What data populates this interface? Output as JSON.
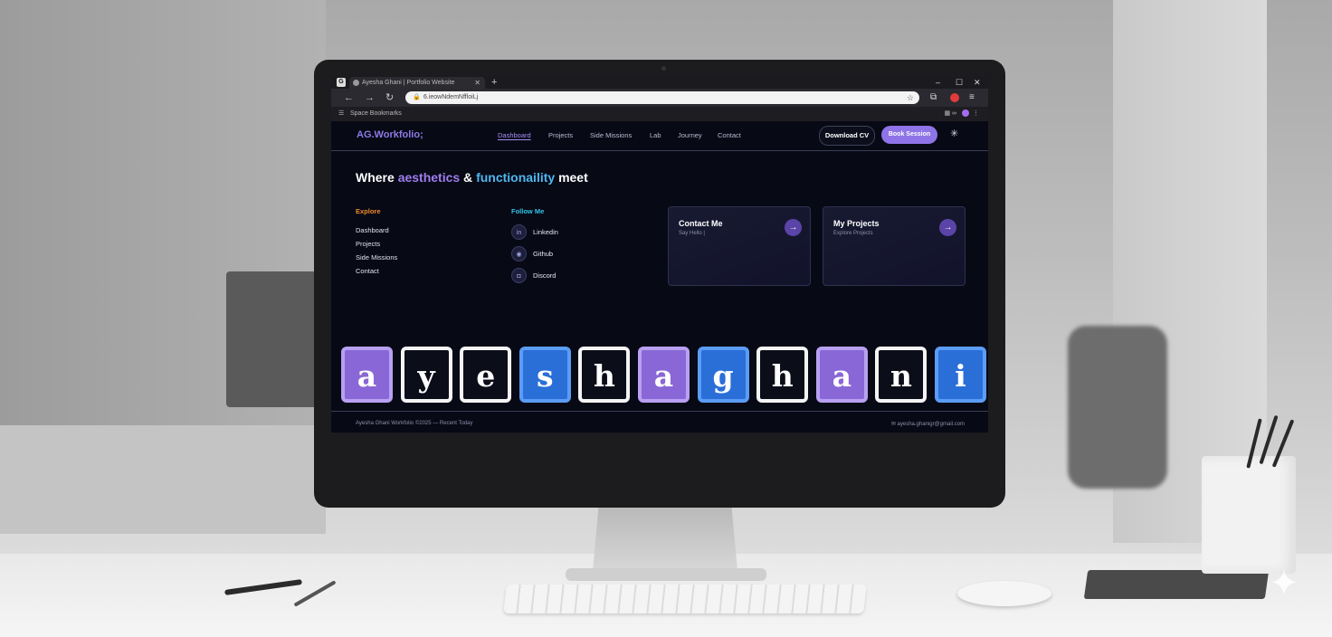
{
  "browser": {
    "app_icon": "G",
    "tab_title": "Ayesha Ghani | Portfolio Website",
    "url": "6.ieowNdemNffloiLj",
    "bookmark_label": "Space Bookmarks",
    "window_controls": [
      "–",
      "☐",
      "✕"
    ]
  },
  "site": {
    "logo": "AG.Workfolio;",
    "nav": [
      {
        "label": "Dashboard",
        "active": true
      },
      {
        "label": "Projects",
        "active": false
      },
      {
        "label": "Side Missions",
        "active": false
      },
      {
        "label": "Lab",
        "active": false
      },
      {
        "label": "Journey",
        "active": false
      },
      {
        "label": "Contact",
        "active": false
      }
    ],
    "download_cv": "Download CV",
    "book_session": "Book Session",
    "accent_purple": "#9f7df0",
    "accent_cyan": "#4fb6f0",
    "accent_orange": "#ef8a2a"
  },
  "hero": {
    "headline_start": "Where ",
    "headline_purple": "aesthetics",
    "headline_mid": " & ",
    "headline_cyan": "functionaility",
    "headline_end": " meet"
  },
  "explore": {
    "heading": "Explore",
    "links": [
      "Dashboard",
      "Projects",
      "Side Missions",
      "Contact"
    ]
  },
  "follow": {
    "heading": "Follow Me",
    "links": [
      {
        "label": "Linkedin",
        "icon": "linkedin-icon"
      },
      {
        "label": "Github",
        "icon": "github-icon"
      },
      {
        "label": "Discord",
        "icon": "discord-icon"
      }
    ]
  },
  "cards": [
    {
      "title": "Contact Me",
      "subtitle": "Say Hello |"
    },
    {
      "title": "My Projects",
      "subtitle": "Explore Projects"
    }
  ],
  "name_tiles": [
    {
      "letter": "a",
      "style": "purple"
    },
    {
      "letter": "y",
      "style": "white"
    },
    {
      "letter": "e",
      "style": "white"
    },
    {
      "letter": "s",
      "style": "blue"
    },
    {
      "letter": "h",
      "style": "white"
    },
    {
      "letter": "a",
      "style": "purple"
    },
    {
      "letter": "g",
      "style": "blue"
    },
    {
      "letter": "h",
      "style": "white"
    },
    {
      "letter": "a",
      "style": "purple"
    },
    {
      "letter": "n",
      "style": "white"
    },
    {
      "letter": "i",
      "style": "blue"
    }
  ],
  "footer": {
    "left": "Ayesha Ghani Workfolio ©2025 — Recent Today",
    "right": "ayesha.ghanigr@gmail.com"
  }
}
